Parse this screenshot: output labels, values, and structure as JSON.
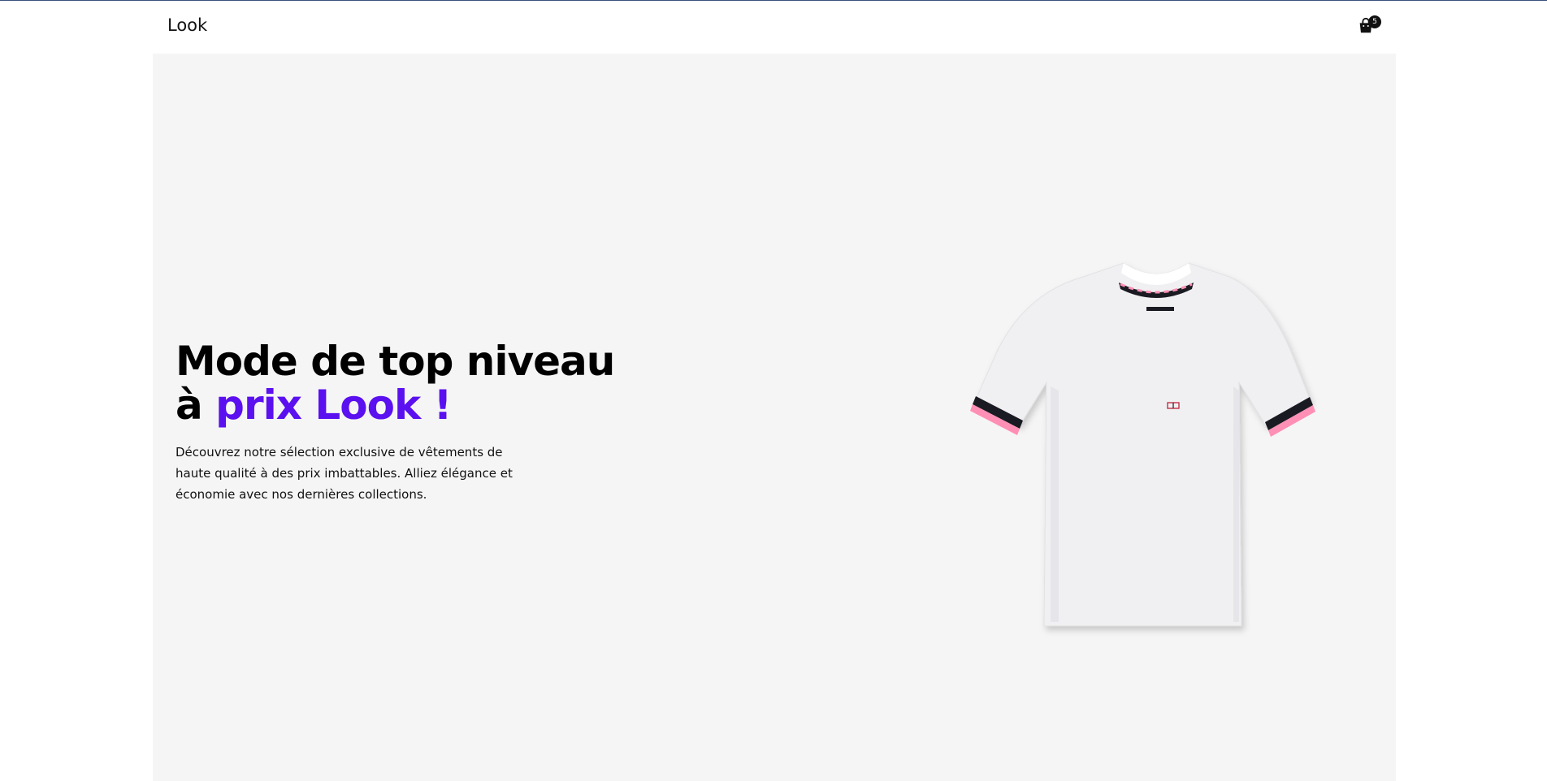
{
  "header": {
    "logo": "Look",
    "cart_count": "5"
  },
  "hero": {
    "title_line1": "Mode de top niveau",
    "title_line2_prefix": "à ",
    "title_line2_accent": "prix Look !",
    "description": "Découvrez notre sélection exclusive de vêtements de haute qualité à des prix imbattables. Alliez élégance et économie avec nos dernières collections."
  },
  "colors": {
    "accent": "#5b10f0",
    "hero_background": "#f5f5f5",
    "cuff_pink": "#ff8fb5"
  },
  "icons": {
    "cart": "shopping-bag-icon"
  }
}
